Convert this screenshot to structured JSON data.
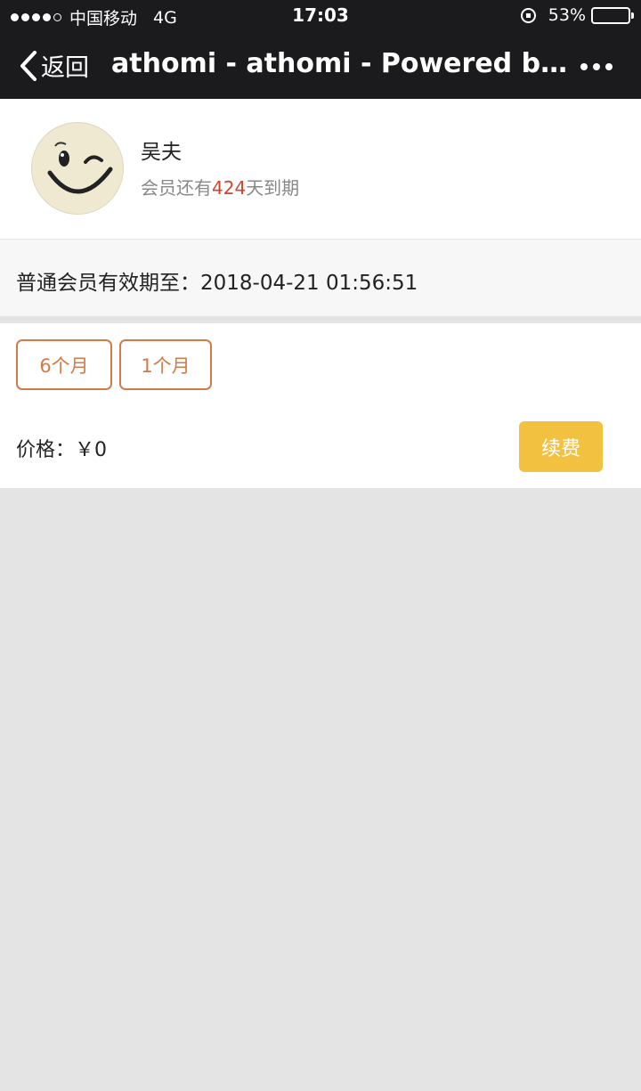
{
  "status_bar": {
    "carrier": "中国移动",
    "network": "4G",
    "time": "17:03",
    "battery": "53%",
    "battery_level": 0.53
  },
  "nav": {
    "back_label": "返回",
    "title": "athomi - athomi - Powered by W..."
  },
  "profile": {
    "name": "吴夫",
    "note_prefix": "会员还有",
    "days": "424",
    "note_suffix": "天到期"
  },
  "validity": {
    "text": "普通会员有效期至：2018-04-21 01:56:51"
  },
  "plans": [
    {
      "label": "6个月"
    },
    {
      "label": "1个月"
    }
  ],
  "price": {
    "text": "价格：￥0"
  },
  "renew_button": {
    "label": "续费"
  },
  "colors": {
    "accent_orange": "#d27a48",
    "button_yellow": "#f1c13f",
    "highlight_red": "#d0442c",
    "header_dark": "#1b1b1d"
  }
}
